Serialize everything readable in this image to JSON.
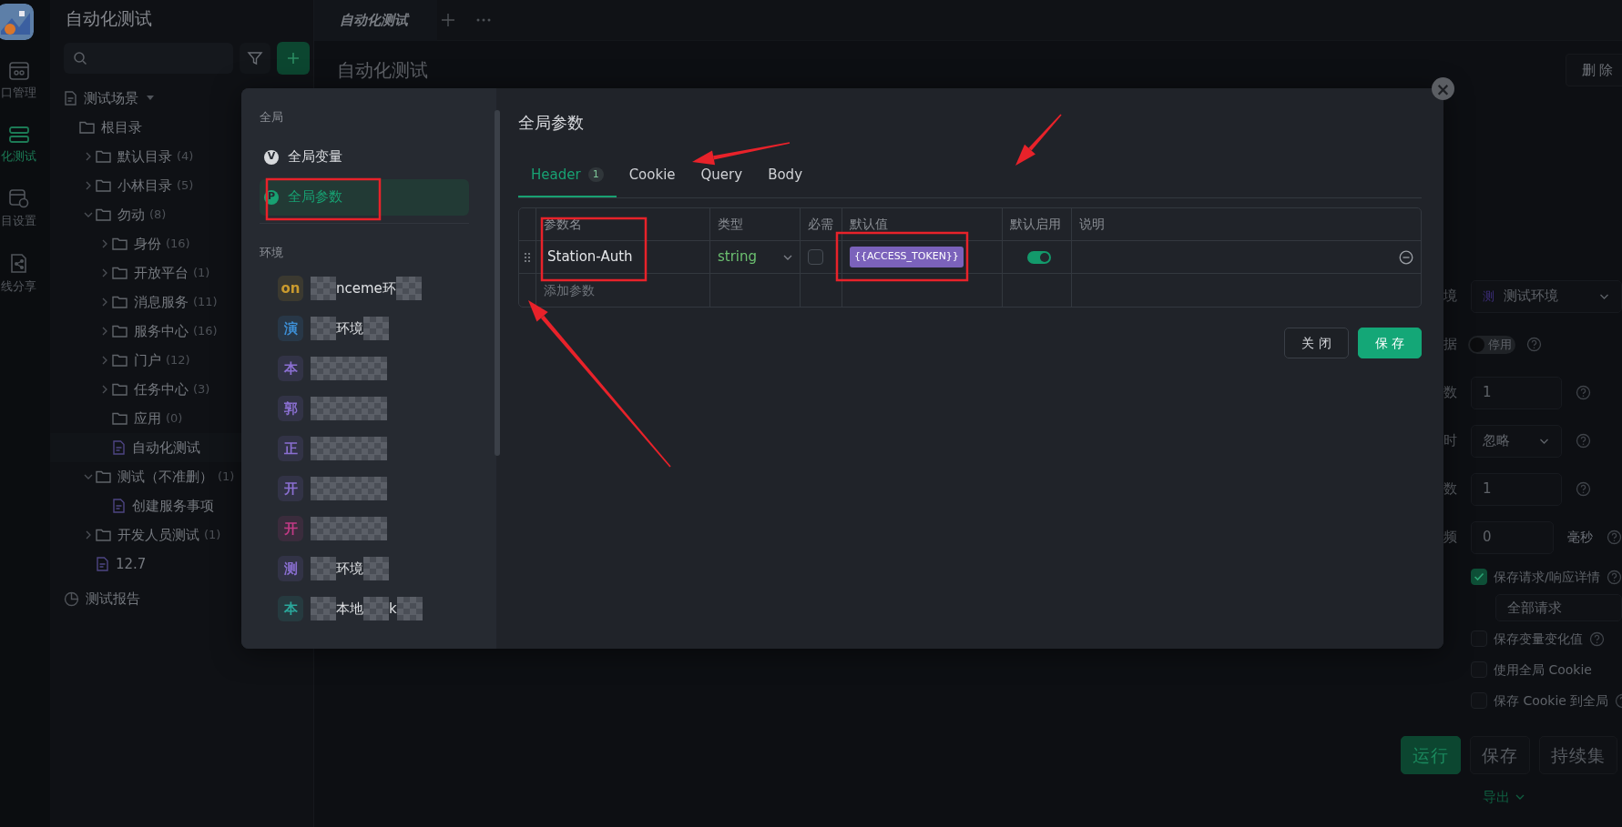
{
  "rail": {
    "items": [
      {
        "label": "口管理",
        "selected": false
      },
      {
        "label": "化测试",
        "selected": true
      },
      {
        "label": "目设置",
        "selected": false
      },
      {
        "label": "线分享",
        "selected": false
      }
    ]
  },
  "tree_panel": {
    "title": "自动化测试",
    "scene": "测试场景",
    "tree": [
      {
        "kind": "folder",
        "label": "根目录",
        "children": [
          {
            "kind": "folder",
            "label": "默认目录",
            "count": "(4)",
            "expanded": false
          },
          {
            "kind": "folder",
            "label": "小林目录",
            "count": "(5)",
            "expanded": false
          },
          {
            "kind": "folder",
            "label": "勿动",
            "count": "(8)",
            "expanded": true,
            "children": [
              {
                "kind": "folder",
                "label": "身份",
                "count": "(16)",
                "expanded": false
              },
              {
                "kind": "folder",
                "label": "开放平台",
                "count": "(1)",
                "expanded": false
              },
              {
                "kind": "folder",
                "label": "消息服务",
                "count": "(11)",
                "expanded": false
              },
              {
                "kind": "folder",
                "label": "服务中心",
                "count": "(16)",
                "expanded": false
              },
              {
                "kind": "folder",
                "label": "门户",
                "count": "(12)",
                "expanded": false
              },
              {
                "kind": "folder",
                "label": "任务中心",
                "count": "(3)",
                "expanded": false
              },
              {
                "kind": "folder",
                "label": "应用",
                "count": "(0)"
              },
              {
                "kind": "scenario",
                "label": "自动化测试",
                "selected": true
              }
            ]
          },
          {
            "kind": "folder",
            "label": "测试（不准删）",
            "count": "(1)",
            "expanded": true,
            "children": [
              {
                "kind": "scenario",
                "label": "创建服务事项",
                "selected": false
              }
            ]
          },
          {
            "kind": "folder",
            "label": "开发人员测试",
            "count": "(1)",
            "expanded": false
          },
          {
            "kind": "scenario",
            "label": "12.7",
            "selected": false
          }
        ]
      }
    ],
    "report": "测试报告"
  },
  "main": {
    "tabs": [
      {
        "label": "自动化测试",
        "selected": true
      }
    ],
    "title": "自动化测试",
    "delete_button": "删 除",
    "settings": [
      {
        "kind": "select",
        "label": "境",
        "badge": "测",
        "value": "测试环境"
      },
      {
        "kind": "switch",
        "label": "据",
        "on": false,
        "text": "停用",
        "help": true
      },
      {
        "kind": "input",
        "label": "数",
        "value": "1",
        "help": true
      },
      {
        "kind": "select",
        "label": "时",
        "value": "忽略",
        "help": true
      },
      {
        "kind": "input",
        "label": "数",
        "value": "1",
        "help": true
      },
      {
        "kind": "input",
        "label": "频",
        "value": "0",
        "unit": "毫秒",
        "help": true
      },
      {
        "kind": "checkbox",
        "label": "保存请求/响应详情",
        "checked": true,
        "help": true
      },
      {
        "kind": "subselect",
        "value": "全部请求"
      },
      {
        "kind": "checkbox",
        "label": "保存变量变化值",
        "checked": false,
        "help": true
      },
      {
        "kind": "checkbox",
        "label": "使用全局 Cookie",
        "checked": false,
        "help": false
      },
      {
        "kind": "checkbox",
        "label": "保存 Cookie 到全局",
        "checked": false,
        "help": true
      }
    ],
    "actions": [
      {
        "label": "运行",
        "kind": "primary"
      },
      {
        "label": "保存",
        "kind": "default"
      },
      {
        "label": "持续集",
        "kind": "default"
      }
    ],
    "export": "导出"
  },
  "modal": {
    "close": "×",
    "sidebar": {
      "global_label": "全局",
      "global_items": [
        {
          "label": "全局变量",
          "letter": "V",
          "selected": false
        },
        {
          "label": "全局参数",
          "letter": "P",
          "selected": true
        }
      ],
      "env_label": "环境",
      "environments": [
        {
          "badge": "on",
          "color": "#c99a2e",
          "fragments": [
            "nceme环"
          ]
        },
        {
          "badge": "演",
          "color": "#3d8fd6",
          "fragments": [
            "环境"
          ]
        },
        {
          "badge": "本",
          "color": "#8a6fd1"
        },
        {
          "badge": "郭",
          "color": "#8a6fd1"
        },
        {
          "badge": "正",
          "color": "#8a6fd1"
        },
        {
          "badge": "开",
          "color": "#8a6fd1"
        },
        {
          "badge": "开",
          "color": "#c23a86"
        },
        {
          "badge": "测",
          "color": "#8a6fd1",
          "fragments": [
            "环境"
          ]
        },
        {
          "badge": "本",
          "color": "#2aa79b",
          "fragments": [
            "本地",
            "k"
          ]
        }
      ]
    },
    "title": "全局参数",
    "tabs": [
      {
        "label": "Header",
        "count": "1",
        "selected": true
      },
      {
        "label": "Cookie",
        "selected": false
      },
      {
        "label": "Query",
        "selected": false
      },
      {
        "label": "Body",
        "selected": false
      }
    ],
    "columns": [
      "参数名",
      "类型",
      "必需",
      "默认值",
      "默认启用",
      "说明"
    ],
    "rows": [
      {
        "name": "Station-Auth",
        "type": "string",
        "required": false,
        "default": "{{ACCESS_TOKEN}}",
        "enabled": true
      }
    ],
    "add_placeholder": "添加参数",
    "buttons": [
      {
        "label": "关 闭",
        "kind": "default"
      },
      {
        "label": "保 存",
        "kind": "primary"
      }
    ]
  }
}
